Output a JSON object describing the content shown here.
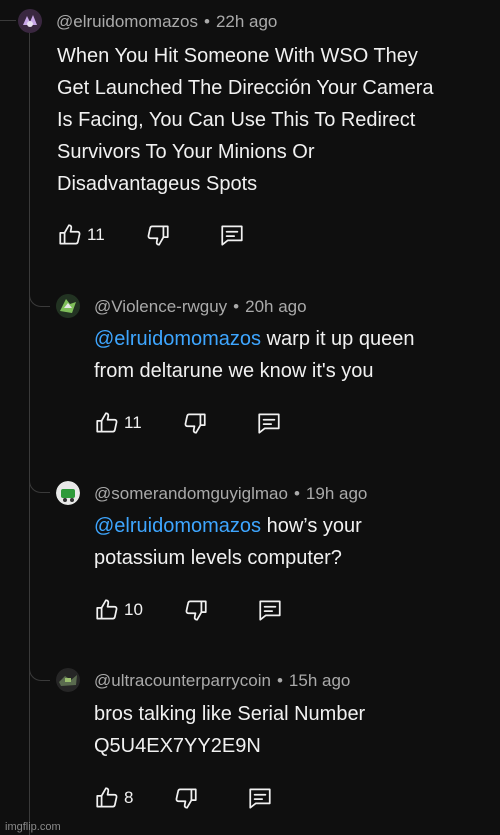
{
  "comment": {
    "author": "@elruidomomazos",
    "time": "22h ago",
    "text_lines": [
      "When You Hit Someone With WSO They",
      "Get Launched The Dirección Your Camera",
      "Is Facing, You Can Use This To Redirect",
      "Survivors To Your Minions Or",
      "Disadvantageus Spots"
    ],
    "likes": "11"
  },
  "replies": [
    {
      "author": "@Violence-rwguy",
      "time": "20h ago",
      "mention": "@elruidomomazos",
      "line1_rest": " warp it up queen",
      "line2": "from deltarune we know it's you",
      "likes": "11"
    },
    {
      "author": "@somerandomguyiglmao",
      "time": "19h ago",
      "mention": "@elruidomomazos",
      "line1_rest": " how’s your",
      "line2": "potassium levels computer?",
      "likes": "10"
    },
    {
      "author": "@ultracounterparrycoin",
      "time": "15h ago",
      "mention": "",
      "line1_rest": "bros talking like Serial Number",
      "line2": "Q5U4EX7YY2E9N",
      "likes": "8"
    }
  ],
  "separator": "•",
  "icons": [
    "like-icon",
    "dislike-icon",
    "reply-icon"
  ],
  "colors": {
    "background": "#0f0f0f",
    "text": "#f1f1f1",
    "meta": "#aaaaaa",
    "mention": "#3ea6ff"
  },
  "watermark": "imgflip.com"
}
